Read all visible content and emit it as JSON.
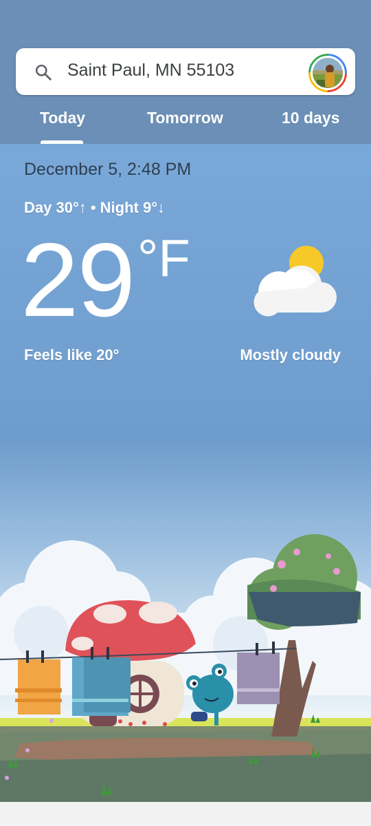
{
  "search": {
    "location": "Saint Paul, MN 55103"
  },
  "tabs": [
    {
      "label": "Today",
      "selected": true
    },
    {
      "label": "Tomorrow",
      "selected": false
    },
    {
      "label": "10 days",
      "selected": false
    }
  ],
  "current": {
    "datetime": "December 5, 2:48 PM",
    "day_night": "Day 30°↑ • Night 9°↓",
    "temperature": "29",
    "unit": "°F",
    "feels_like": "Feels like 20°",
    "condition": "Mostly cloudy",
    "condition_icon": "mostly-cloudy-icon"
  },
  "colors": {
    "header": "#6b8fb6",
    "sky_top": "#79a8d8",
    "text_dark": "#2e3f52",
    "google_red": "#ea4335",
    "google_yellow": "#fbbc05",
    "google_green": "#34a853",
    "google_blue": "#4285f4"
  }
}
